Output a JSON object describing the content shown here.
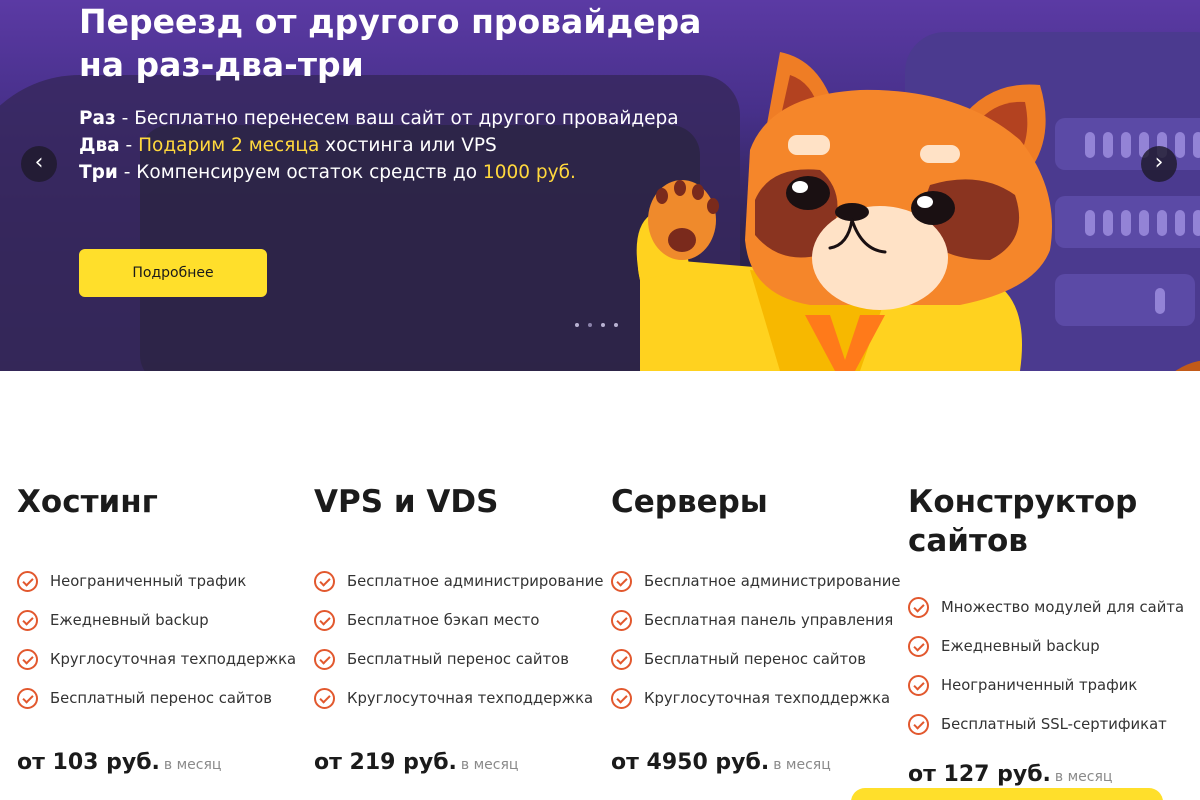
{
  "hero": {
    "title": "Переезд от другого провайдера на раз-два-три",
    "lines": [
      {
        "term": "Раз",
        "sep": " - ",
        "text": "Бесплатно перенесем ваш сайт от другого провайдера",
        "highlight": "",
        "tail": ""
      },
      {
        "term": "Два",
        "sep": " - ",
        "text": "",
        "highlight": "Подарим 2 месяца",
        "tail": " хостинга или VPS"
      },
      {
        "term": "Три",
        "sep": " - ",
        "text": "Компенсируем остаток средств до ",
        "highlight": "1000 руб.",
        "tail": ""
      }
    ],
    "cta_label": "Подробнее",
    "prev_icon": "chevron-left-icon",
    "next_icon": "chevron-right-icon",
    "slides_count": 4,
    "active_slide": 1,
    "mascot": "fox-mascot"
  },
  "colors": {
    "accent_yellow": "#ffdf2b",
    "highlight_yellow": "#ffd83d",
    "check_orange": "#e2582e",
    "hero_purple": "#47308a"
  },
  "plans": [
    {
      "title": "Хостинг",
      "features": [
        "Неограниченный трафик",
        "Ежедневный backup",
        "Круглосуточная техподдержка",
        "Бесплатный перенос сайтов"
      ],
      "price": "от 103 руб.",
      "period": "в месяц"
    },
    {
      "title": "VPS и VDS",
      "features": [
        "Бесплатное администрирование",
        "Бесплатное бэкап место",
        "Бесплатный перенос сайтов",
        "Круглосуточная техподдержка"
      ],
      "price": "от 219 руб.",
      "period": "в месяц"
    },
    {
      "title": "Серверы",
      "features": [
        "Бесплатное администрирование",
        "Бесплатная панель управления",
        "Бесплатный перенос сайтов",
        "Круглосуточная техподдержка"
      ],
      "price": "от 4950 руб.",
      "period": "в месяц"
    },
    {
      "title": "Конструктор сайтов",
      "features": [
        "Множество модулей для сайта",
        "Ежедневный backup",
        "Неограниченный трафик",
        "Бесплатный SSL-сертификат"
      ],
      "price": "от 127 руб.",
      "period": "в месяц"
    }
  ]
}
